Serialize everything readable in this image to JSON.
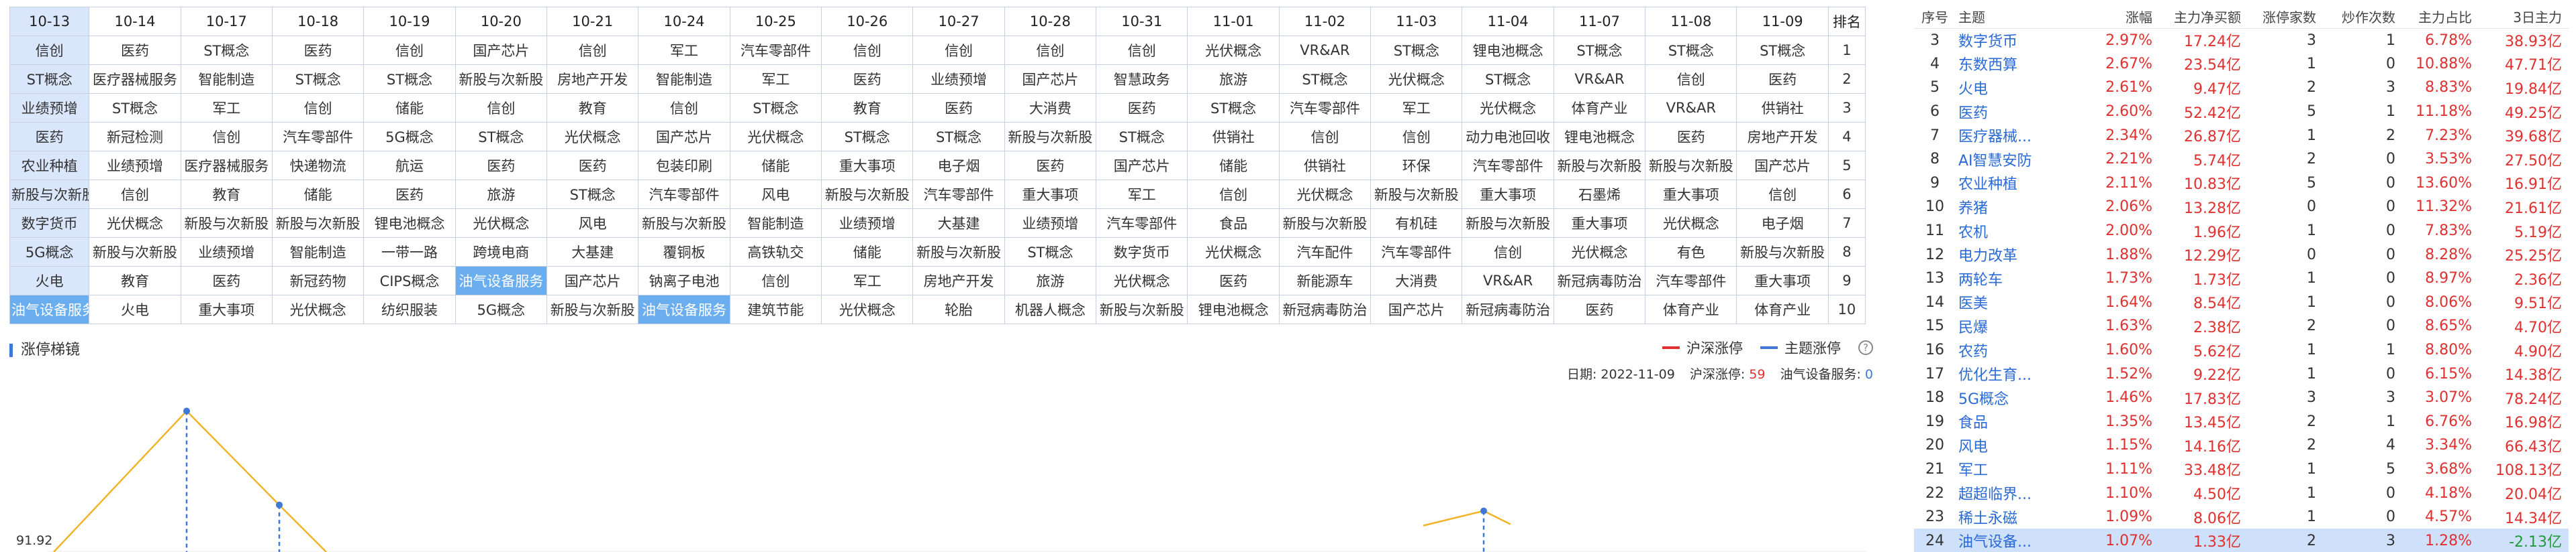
{
  "grid": {
    "dates": [
      "10-13",
      "10-14",
      "10-17",
      "10-18",
      "10-19",
      "10-20",
      "10-21",
      "10-24",
      "10-25",
      "10-26",
      "10-27",
      "10-28",
      "10-31",
      "11-01",
      "11-02",
      "11-03",
      "11-04",
      "11-07",
      "11-08",
      "11-09"
    ],
    "rank_header": "排名",
    "rows": [
      {
        "rank": "1",
        "cells": [
          "信创",
          "医药",
          "ST概念",
          "医药",
          "信创",
          "国产芯片",
          "信创",
          "军工",
          "汽车零部件",
          "信创",
          "信创",
          "信创",
          "信创",
          "光伏概念",
          "VR&AR",
          "ST概念",
          "锂电池概念",
          "ST概念",
          "ST概念",
          "ST概念"
        ]
      },
      {
        "rank": "2",
        "cells": [
          "ST概念",
          "医疗器械服务",
          "智能制造",
          "ST概念",
          "ST概念",
          "新股与次新股",
          "房地产开发",
          "智能制造",
          "军工",
          "医药",
          "业绩预增",
          "国产芯片",
          "智慧政务",
          "旅游",
          "ST概念",
          "光伏概念",
          "ST概念",
          "VR&AR",
          "信创",
          "医药"
        ]
      },
      {
        "rank": "3",
        "cells": [
          "业绩预增",
          "ST概念",
          "军工",
          "信创",
          "储能",
          "信创",
          "教育",
          "信创",
          "ST概念",
          "教育",
          "医药",
          "大消费",
          "医药",
          "ST概念",
          "汽车零部件",
          "军工",
          "光伏概念",
          "体育产业",
          "VR&AR",
          "供销社"
        ]
      },
      {
        "rank": "4",
        "cells": [
          "医药",
          "新冠检测",
          "信创",
          "汽车零部件",
          "5G概念",
          "ST概念",
          "光伏概念",
          "国产芯片",
          "光伏概念",
          "ST概念",
          "ST概念",
          "新股与次新股",
          "ST概念",
          "供销社",
          "信创",
          "信创",
          "动力电池回收",
          "锂电池概念",
          "医药",
          "房地产开发"
        ]
      },
      {
        "rank": "5",
        "cells": [
          "农业种植",
          "业绩预增",
          "医疗器械服务",
          "快递物流",
          "航运",
          "医药",
          "医药",
          "包装印刷",
          "储能",
          "重大事项",
          "电子烟",
          "医药",
          "国产芯片",
          "储能",
          "供销社",
          "环保",
          "汽车零部件",
          "新股与次新股",
          "新股与次新股",
          "国产芯片"
        ]
      },
      {
        "rank": "6",
        "cells": [
          "新股与次新股",
          "信创",
          "教育",
          "储能",
          "医药",
          "旅游",
          "ST概念",
          "汽车零部件",
          "风电",
          "新股与次新股",
          "汽车零部件",
          "重大事项",
          "军工",
          "信创",
          "光伏概念",
          "新股与次新股",
          "重大事项",
          "石墨烯",
          "重大事项",
          "信创"
        ]
      },
      {
        "rank": "7",
        "cells": [
          "数字货币",
          "光伏概念",
          "新股与次新股",
          "新股与次新股",
          "锂电池概念",
          "光伏概念",
          "风电",
          "新股与次新股",
          "智能制造",
          "业绩预增",
          "大基建",
          "业绩预增",
          "汽车零部件",
          "食品",
          "新股与次新股",
          "有机硅",
          "新股与次新股",
          "重大事项",
          "光伏概念",
          "电子烟"
        ]
      },
      {
        "rank": "8",
        "cells": [
          "5G概念",
          "新股与次新股",
          "业绩预增",
          "智能制造",
          "一带一路",
          "跨境电商",
          "大基建",
          "覆铜板",
          "高铁轨交",
          "储能",
          "新股与次新股",
          "ST概念",
          "数字货币",
          "光伏概念",
          "汽车配件",
          "汽车零部件",
          "信创",
          "光伏概念",
          "有色",
          "新股与次新股"
        ]
      },
      {
        "rank": "9",
        "cells": [
          "火电",
          "教育",
          "医药",
          "新冠药物",
          "CIPS概念",
          "油气设备服务",
          "国产芯片",
          "钠离子电池",
          "信创",
          "军工",
          "房地产开发",
          "旅游",
          "光伏概念",
          "医药",
          "新能源车",
          "大消费",
          "VR&AR",
          "新冠病毒防治",
          "汽车零部件",
          "重大事项"
        ]
      },
      {
        "rank": "10",
        "cells": [
          "油气设备服务",
          "火电",
          "重大事项",
          "光伏概念",
          "纺织服装",
          "5G概念",
          "新股与次新股",
          "油气设备服务",
          "建筑节能",
          "光伏概念",
          "轮胎",
          "机器人概念",
          "新股与次新股",
          "锂电池概念",
          "新冠病毒防治",
          "国产芯片",
          "新冠病毒防治",
          "医药",
          "体育产业",
          "体育产业"
        ]
      }
    ],
    "highlight_text": "油气设备服务"
  },
  "chart": {
    "title": "涨停梯镜",
    "legend": [
      {
        "label": "沪深涨停",
        "color": "#e03030"
      },
      {
        "label": "主题涨停",
        "color": "#3f78d6"
      }
    ],
    "help_icon": "help-circle-icon",
    "info": {
      "date_label": "日期:",
      "date_value": "2022-11-09",
      "market_label": "沪深涨停:",
      "market_value": "59",
      "theme_label": "油气设备服务:",
      "theme_value": "0"
    },
    "y_tick": "91.92"
  },
  "chart_data": {
    "type": "line",
    "title": "涨停梯镜",
    "series": [
      {
        "name": "沪深涨停",
        "color": "#f0b429",
        "values": [
          null,
          100,
          92,
          null,
          null,
          null,
          null,
          null,
          null,
          null,
          null,
          null,
          null,
          null,
          null,
          91.5
        ]
      }
    ],
    "y_tick_visible": [
      91.92
    ]
  },
  "themes": {
    "headers": [
      "序号",
      "主题",
      "涨幅",
      "主力净买额",
      "涨停家数",
      "炒作次数",
      "主力占比",
      "3日主力"
    ],
    "rows": [
      {
        "idx": "3",
        "name": "数字货币",
        "chg": "2.97%",
        "net": "17.24亿",
        "limit": "3",
        "hype": "1",
        "ratio": "6.78%",
        "d3": "38.93亿",
        "d3_dir": "red"
      },
      {
        "idx": "4",
        "name": "东数西算",
        "chg": "2.67%",
        "net": "23.54亿",
        "limit": "1",
        "hype": "0",
        "ratio": "10.88%",
        "d3": "47.71亿",
        "d3_dir": "red"
      },
      {
        "idx": "5",
        "name": "火电",
        "chg": "2.61%",
        "net": "9.47亿",
        "limit": "2",
        "hype": "3",
        "ratio": "8.83%",
        "d3": "19.84亿",
        "d3_dir": "red"
      },
      {
        "idx": "6",
        "name": "医药",
        "chg": "2.60%",
        "net": "52.42亿",
        "limit": "5",
        "hype": "1",
        "ratio": "11.18%",
        "d3": "49.25亿",
        "d3_dir": "red"
      },
      {
        "idx": "7",
        "name": "医疗器械...",
        "chg": "2.34%",
        "net": "26.87亿",
        "limit": "1",
        "hype": "2",
        "ratio": "7.23%",
        "d3": "39.68亿",
        "d3_dir": "red"
      },
      {
        "idx": "8",
        "name": "AI智慧安防",
        "chg": "2.21%",
        "net": "5.74亿",
        "limit": "2",
        "hype": "0",
        "ratio": "3.53%",
        "d3": "27.50亿",
        "d3_dir": "red"
      },
      {
        "idx": "9",
        "name": "农业种植",
        "chg": "2.11%",
        "net": "10.83亿",
        "limit": "5",
        "hype": "0",
        "ratio": "13.60%",
        "d3": "16.91亿",
        "d3_dir": "red"
      },
      {
        "idx": "10",
        "name": "养猪",
        "chg": "2.06%",
        "net": "13.28亿",
        "limit": "0",
        "hype": "0",
        "ratio": "11.32%",
        "d3": "21.61亿",
        "d3_dir": "red"
      },
      {
        "idx": "11",
        "name": "农机",
        "chg": "2.00%",
        "net": "1.96亿",
        "limit": "1",
        "hype": "0",
        "ratio": "7.83%",
        "d3": "5.19亿",
        "d3_dir": "red"
      },
      {
        "idx": "12",
        "name": "电力改革",
        "chg": "1.88%",
        "net": "12.29亿",
        "limit": "0",
        "hype": "0",
        "ratio": "8.28%",
        "d3": "25.25亿",
        "d3_dir": "red"
      },
      {
        "idx": "13",
        "name": "两轮车",
        "chg": "1.73%",
        "net": "1.73亿",
        "limit": "1",
        "hype": "0",
        "ratio": "8.97%",
        "d3": "2.36亿",
        "d3_dir": "red"
      },
      {
        "idx": "14",
        "name": "医美",
        "chg": "1.64%",
        "net": "8.54亿",
        "limit": "1",
        "hype": "0",
        "ratio": "8.06%",
        "d3": "9.51亿",
        "d3_dir": "red"
      },
      {
        "idx": "15",
        "name": "民爆",
        "chg": "1.63%",
        "net": "2.38亿",
        "limit": "2",
        "hype": "0",
        "ratio": "8.65%",
        "d3": "4.70亿",
        "d3_dir": "red"
      },
      {
        "idx": "16",
        "name": "农药",
        "chg": "1.60%",
        "net": "5.62亿",
        "limit": "1",
        "hype": "1",
        "ratio": "8.80%",
        "d3": "4.90亿",
        "d3_dir": "red"
      },
      {
        "idx": "17",
        "name": "优化生育...",
        "chg": "1.52%",
        "net": "9.22亿",
        "limit": "1",
        "hype": "0",
        "ratio": "6.15%",
        "d3": "14.38亿",
        "d3_dir": "red"
      },
      {
        "idx": "18",
        "name": "5G概念",
        "chg": "1.46%",
        "net": "17.83亿",
        "limit": "3",
        "hype": "3",
        "ratio": "3.07%",
        "d3": "78.24亿",
        "d3_dir": "red"
      },
      {
        "idx": "19",
        "name": "食品",
        "chg": "1.35%",
        "net": "13.45亿",
        "limit": "2",
        "hype": "1",
        "ratio": "6.76%",
        "d3": "16.98亿",
        "d3_dir": "red"
      },
      {
        "idx": "20",
        "name": "风电",
        "chg": "1.15%",
        "net": "14.16亿",
        "limit": "2",
        "hype": "4",
        "ratio": "3.34%",
        "d3": "66.43亿",
        "d3_dir": "red"
      },
      {
        "idx": "21",
        "name": "军工",
        "chg": "1.11%",
        "net": "33.48亿",
        "limit": "1",
        "hype": "5",
        "ratio": "3.68%",
        "d3": "108.13亿",
        "d3_dir": "red"
      },
      {
        "idx": "22",
        "name": "超超临界...",
        "chg": "1.10%",
        "net": "4.50亿",
        "limit": "1",
        "hype": "0",
        "ratio": "4.18%",
        "d3": "20.04亿",
        "d3_dir": "red"
      },
      {
        "idx": "23",
        "name": "稀土永磁",
        "chg": "1.09%",
        "net": "8.06亿",
        "limit": "1",
        "hype": "0",
        "ratio": "4.57%",
        "d3": "14.34亿",
        "d3_dir": "red"
      },
      {
        "idx": "24",
        "name": "油气设备...",
        "chg": "1.07%",
        "net": "1.33亿",
        "limit": "2",
        "hype": "3",
        "ratio": "1.28%",
        "d3": "-2.13亿",
        "d3_dir": "green"
      }
    ],
    "selected_idx": "24"
  }
}
